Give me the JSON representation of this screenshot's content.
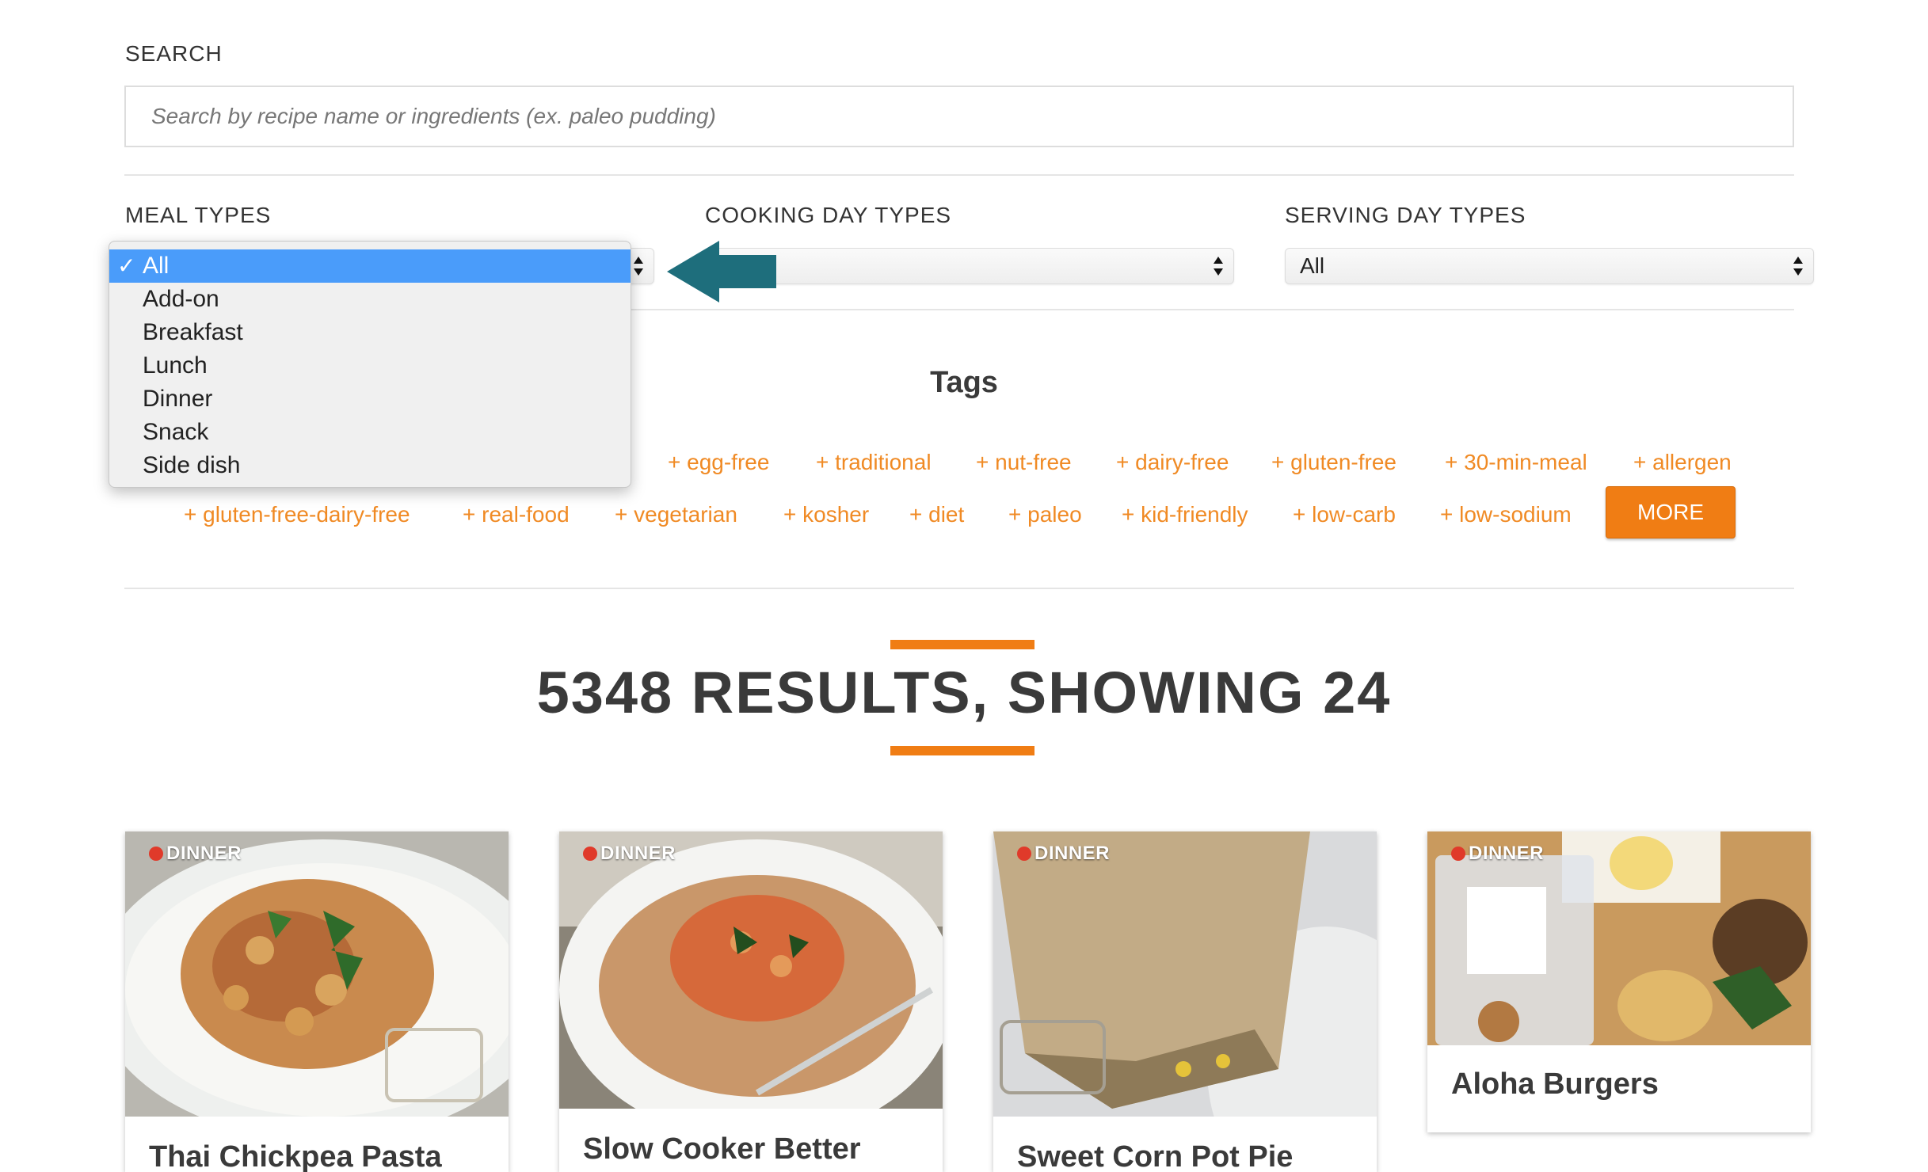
{
  "search": {
    "label": "SEARCH",
    "placeholder": "Search by recipe name or ingredients (ex. paleo pudding)"
  },
  "filters": {
    "meal_types": {
      "label": "MEAL TYPES",
      "selected": "All",
      "options": [
        "All",
        "Add-on",
        "Breakfast",
        "Lunch",
        "Dinner",
        "Snack",
        "Side dish"
      ],
      "check_icon": "✓"
    },
    "cooking_day_types": {
      "label": "COOKING DAY TYPES",
      "value": ""
    },
    "serving_day_types": {
      "label": "SERVING DAY TYPES",
      "value": "All"
    }
  },
  "annotation_arrow": {
    "icon": "left-arrow-icon",
    "color": "#1e6e7c"
  },
  "tags": {
    "heading": "Tags",
    "row1": [
      "+ egg-free",
      "+ traditional",
      "+ nut-free",
      "+ dairy-free",
      "+ gluten-free",
      "+ 30-min-meal",
      "+ allergen"
    ],
    "row2": [
      "+ gluten-free-dairy-free",
      "+ real-food",
      "+ vegetarian",
      "+ kosher",
      "+ diet",
      "+ paleo",
      "+ kid-friendly",
      "+ low-carb",
      "+ low-sodium"
    ],
    "more_label": "MORE"
  },
  "results": {
    "heading": "5348 RESULTS, SHOWING 24"
  },
  "cards": [
    {
      "badge": "DINNER",
      "title": "Thai Chickpea Pasta"
    },
    {
      "badge": "DINNER",
      "title": "Slow Cooker Better"
    },
    {
      "badge": "DINNER",
      "title": "Sweet Corn Pot Pie"
    },
    {
      "badge": "DINNER",
      "title": "Aloha Burgers"
    }
  ],
  "colors": {
    "accent": "#f07d14",
    "tag": "#f08a24",
    "selected_option": "#4a9cfa",
    "badge_dot": "#e03a2a"
  }
}
